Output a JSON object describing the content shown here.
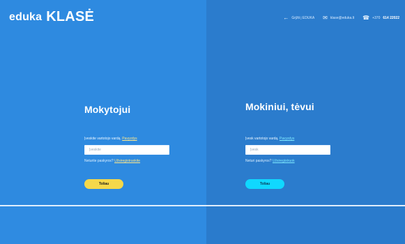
{
  "brand": {
    "logo_main": "eduka",
    "logo_sub": "KLASĖ"
  },
  "topbar": {
    "back_label": "Grįžti į EDUKA",
    "email": "klase@eduka.lt",
    "phone_prefix": "+370",
    "phone_main": "614 22022"
  },
  "left": {
    "title": "Mokytojui",
    "prompt_prefix": "Įveskite vartotojo vardą.",
    "prompt_link": "Pavyzdys",
    "input_placeholder": "Įveskite",
    "note_prefix": "Neturite paskyros?",
    "note_link": "Užsiregistruokite",
    "button": "Toliau"
  },
  "right": {
    "title": "Mokiniui, tėvui",
    "prompt_prefix": "Įvesk vartotojo vardą.",
    "prompt_link": "Pavyzdys",
    "input_placeholder": "Įvesk",
    "note_prefix": "Neturi paskyros?",
    "note_link": "Užsiregistruok",
    "button": "Toliau"
  },
  "icons": {
    "back": "arrow-left-icon",
    "email": "mail-icon",
    "phone": "phone-icon"
  },
  "colors": {
    "left_bg": "#2e8ae0",
    "right_bg": "#2b7ccd",
    "yellow": "#f5d84a",
    "cyan": "#10d8ff"
  }
}
